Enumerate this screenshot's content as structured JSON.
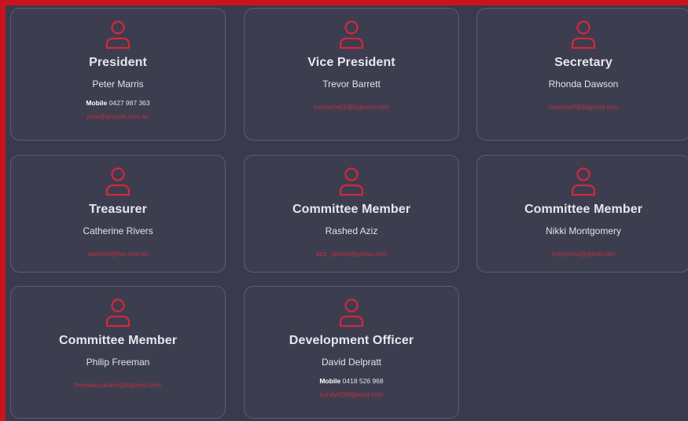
{
  "accent_color": "#d4283a",
  "frame_color": "#c8141c",
  "icon": "user-icon",
  "mobile_label": "Mobile",
  "members": [
    {
      "role": "President",
      "name": "Peter Marris",
      "mobile": "0427 987 363",
      "email": "pete@proavia.com.au"
    },
    {
      "role": "Vice President",
      "name": "Trevor Barrett",
      "mobile": null,
      "email": "trevbarrett1@bigpond.com"
    },
    {
      "role": "Secretary",
      "name": "Rhonda Dawson",
      "mobile": null,
      "email": "rdawson3@bigpond.com"
    },
    {
      "role": "Treasurer",
      "name": "Catherine Rivers",
      "mobile": null,
      "email": "carivers@live.com.au"
    },
    {
      "role": "Committee Member",
      "name": "Rashed Aziz",
      "mobile": null,
      "email": "aziz_rashed@yahoo.com"
    },
    {
      "role": "Committee Member",
      "name": "Nikki Montgomery",
      "mobile": null,
      "email": "jmnycricut@gmail.com"
    },
    {
      "role": "Committee Member",
      "name": "Philip Freeman",
      "mobile": null,
      "email": "freeman.packer@bigpond.com"
    },
    {
      "role": "Development Officer",
      "name": "David Delpratt",
      "mobile": "0418 526 968",
      "email": "bundytt@bigpond.com"
    }
  ]
}
